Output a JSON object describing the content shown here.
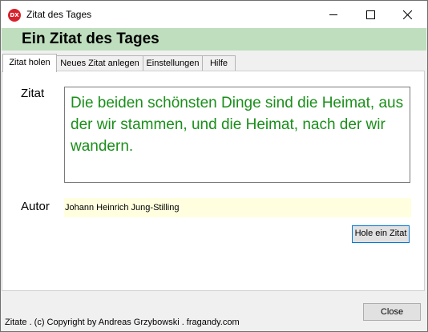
{
  "window": {
    "title": "Zitat des Tages",
    "icon_text": "DX",
    "icon_color": "#d8212b"
  },
  "header": {
    "text": "Ein Zitat des Tages",
    "bg_color": "#bedebe"
  },
  "tabs": [
    {
      "label": "Zitat holen",
      "active": true
    },
    {
      "label": "Neues Zitat anlegen",
      "active": false
    },
    {
      "label": "Einstellungen",
      "active": false
    },
    {
      "label": "Hilfe",
      "active": false
    }
  ],
  "form": {
    "quote_label": "Zitat",
    "quote_text": "Die beiden schönsten Dinge sind die Heimat, aus der wir stammen, und die Heimat, nach der wir wandern.",
    "quote_color": "#1a8f1a",
    "author_label": "Autor",
    "author_value": "Johann Heinrich Jung-Stilling",
    "author_field_color": "#ffffe0",
    "fetch_button": "Hole ein  Zitat"
  },
  "footer": {
    "copyright": "Zitate . (c) Copyright by Andreas Grzybowski . fragandy.com",
    "close_button": "Close"
  }
}
